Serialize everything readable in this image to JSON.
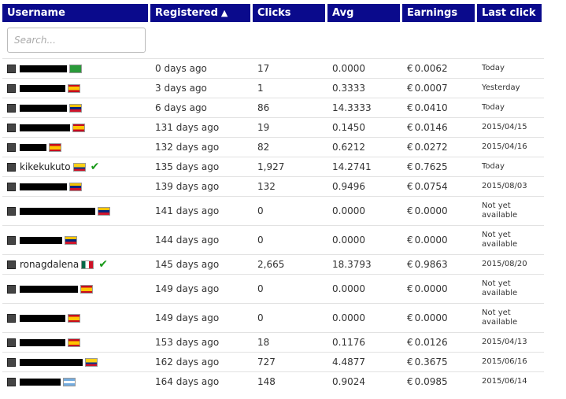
{
  "colors": {
    "header_bg": "#0a0a8c",
    "header_text": "#ffffff",
    "verified": "#1a9a1a"
  },
  "headers": {
    "username": "Username",
    "registered": "Registered",
    "clicks": "Clicks",
    "avg": "Avg",
    "earnings": "Earnings",
    "last_click": "Last click"
  },
  "search": {
    "placeholder": "Search..."
  },
  "currency": "€",
  "rows": [
    {
      "username": "",
      "flag": "brazil",
      "registered": "0 days ago",
      "clicks": "17",
      "avg": "0.0000",
      "earnings": "0.0062",
      "last_click": "Today"
    },
    {
      "username": "",
      "flag": "spain",
      "registered": "3 days ago",
      "clicks": "1",
      "avg": "0.3333",
      "earnings": "0.0007",
      "last_click": "Yesterday"
    },
    {
      "username": "",
      "flag": "venezuela",
      "registered": "6 days ago",
      "clicks": "86",
      "avg": "14.3333",
      "earnings": "0.0410",
      "last_click": "Today"
    },
    {
      "username": "",
      "flag": "spain",
      "registered": "131 days ago",
      "clicks": "19",
      "avg": "0.1450",
      "earnings": "0.0146",
      "last_click": "2015/04/15"
    },
    {
      "username": "",
      "flag": "spain",
      "registered": "132 days ago",
      "clicks": "82",
      "avg": "0.6212",
      "earnings": "0.0272",
      "last_click": "2015/04/16"
    },
    {
      "username": "kikekukuto",
      "flag": "colombia",
      "verified": true,
      "registered": "135 days ago",
      "clicks": "1,927",
      "avg": "14.2741",
      "earnings": "0.7625",
      "last_click": "Today"
    },
    {
      "username": "",
      "flag": "venezuela",
      "registered": "139 days ago",
      "clicks": "132",
      "avg": "0.9496",
      "earnings": "0.0754",
      "last_click": "2015/08/03"
    },
    {
      "username": "",
      "flag": "venezuela",
      "registered": "141 days ago",
      "clicks": "0",
      "avg": "0.0000",
      "earnings": "0.0000",
      "last_click": "Not yet available"
    },
    {
      "username": "",
      "flag": "venezuela",
      "registered": "144 days ago",
      "clicks": "0",
      "avg": "0.0000",
      "earnings": "0.0000",
      "last_click": "Not yet available"
    },
    {
      "username": "ronagdalena",
      "flag": "mexico",
      "verified": true,
      "registered": "145 days ago",
      "clicks": "2,665",
      "avg": "18.3793",
      "earnings": "0.9863",
      "last_click": "2015/08/20"
    },
    {
      "username": "",
      "flag": "spain",
      "registered": "149 days ago",
      "clicks": "0",
      "avg": "0.0000",
      "earnings": "0.0000",
      "last_click": "Not yet available"
    },
    {
      "username": "",
      "flag": "spain",
      "registered": "149 days ago",
      "clicks": "0",
      "avg": "0.0000",
      "earnings": "0.0000",
      "last_click": "Not yet available"
    },
    {
      "username": "",
      "flag": "spain",
      "registered": "153 days ago",
      "clicks": "18",
      "avg": "0.1176",
      "earnings": "0.0126",
      "last_click": "2015/04/13"
    },
    {
      "username": "",
      "flag": "colombia",
      "registered": "162 days ago",
      "clicks": "727",
      "avg": "4.4877",
      "earnings": "0.3675",
      "last_click": "2015/06/16"
    },
    {
      "username": "",
      "flag": "argentina",
      "registered": "164 days ago",
      "clicks": "148",
      "avg": "0.9024",
      "earnings": "0.0985",
      "last_click": "2015/06/14"
    }
  ]
}
